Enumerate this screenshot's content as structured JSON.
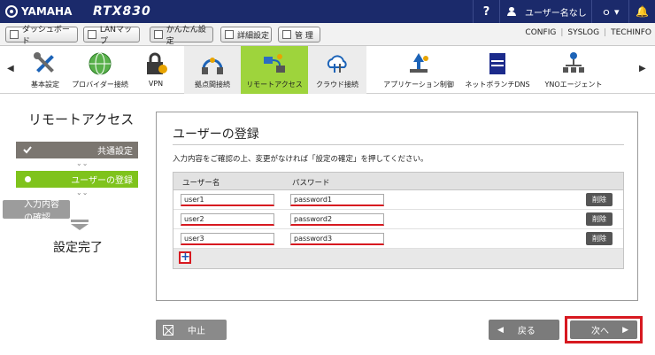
{
  "topbar": {
    "brand": "YAMAHA",
    "model": "RTX830",
    "help": "?",
    "user": "ユーザー名なし",
    "status": "ｏ ▾",
    "bell": "🔔"
  },
  "tabs": [
    {
      "label": "ダッシュボード"
    },
    {
      "label": "LANマップ"
    },
    {
      "label": "かんたん設定"
    },
    {
      "label": "詳細設定"
    },
    {
      "label": "管 理"
    }
  ],
  "links": [
    "CONFIG",
    "SYSLOG",
    "TECHINFO"
  ],
  "iconbar": {
    "left_arrow": "◀",
    "right_arrow": "▶",
    "items": [
      {
        "label": "基本設定",
        "icon": "tools-icon"
      },
      {
        "label": "プロバイダー接続",
        "icon": "globe-icon"
      },
      {
        "label": "VPN",
        "icon": "vpn-lock-icon"
      },
      {
        "label": "拠点間接続",
        "icon": "site-vpn-icon"
      },
      {
        "label": "リモートアクセス",
        "icon": "remote-access-icon"
      },
      {
        "label": "クラウド接続",
        "icon": "cloud-icon"
      },
      {
        "label": "アプリケーション制御",
        "icon": "application-control-icon"
      },
      {
        "label": "ネットボランチDNS",
        "icon": "dns-icon"
      },
      {
        "label": "YNOエージェント",
        "icon": "yno-agent-icon"
      }
    ]
  },
  "sidebar": {
    "title": "リモートアクセス",
    "steps": [
      "共通設定",
      "ユーザーの登録",
      "入力内容の確認"
    ],
    "chevron": "⌄⌄",
    "finish": "設定完了"
  },
  "panel": {
    "title": "ユーザーの登録",
    "desc": "入力内容をご確認の上、変更がなければ「設定の確定」を押してください。",
    "col_user": "ユーザー名",
    "col_pass": "パスワード",
    "rows": [
      {
        "user": "user1",
        "pass": "password1",
        "del": "削除"
      },
      {
        "user": "user2",
        "pass": "password2",
        "del": "削除"
      },
      {
        "user": "user3",
        "pass": "password3",
        "del": "削除"
      }
    ],
    "add": "+"
  },
  "buttons": {
    "cancel": "中止",
    "back": "戻る",
    "back_icon": "◀",
    "next": "次へ",
    "next_icon": "▶"
  },
  "colors": {
    "header": "#1b2a6b",
    "selected": "#9ed43c",
    "current_step": "#7fc31c",
    "highlight": "#d71920"
  }
}
